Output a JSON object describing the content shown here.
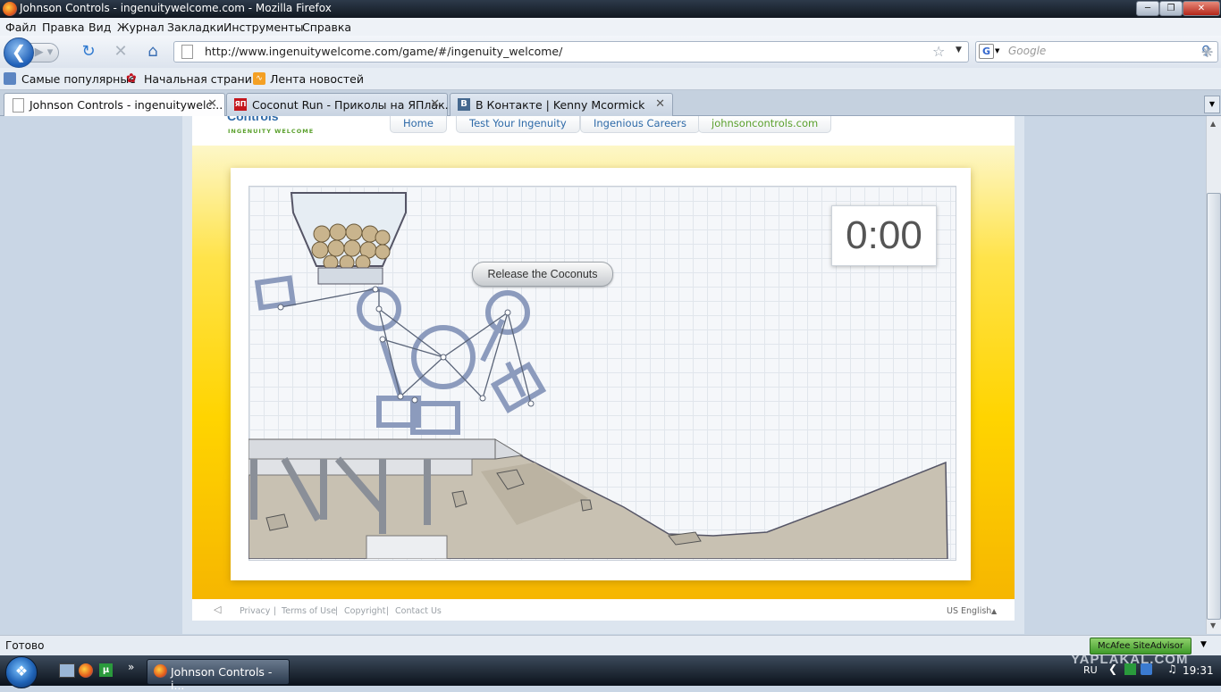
{
  "window": {
    "title": "Johnson Controls - ingenuitywelcome.com - Mozilla Firefox"
  },
  "menu": [
    "Файл",
    "Правка",
    "Вид",
    "Журнал",
    "Закладки",
    "Инструменты",
    "Справка"
  ],
  "nav": {
    "url": "http://www.ingenuitywelcome.com/game/#/ingenuity_welcome/",
    "search_placeholder": "Google"
  },
  "bookmarks": [
    "Самые популярные",
    "Начальная страница",
    "Лента новостей"
  ],
  "tabs": [
    {
      "label": "Johnson Controls - ingenuitywelc...",
      "active": true
    },
    {
      "label": "Coconut Run - Приколы на ЯПлак...",
      "icon": "ЯП"
    },
    {
      "label": "В Контакте | Kenny Mcormick",
      "icon": "B"
    }
  ],
  "site": {
    "logo_text": "Controls",
    "logo_sub": "INGENUITY WELCOME",
    "nav": [
      "Home",
      "Test Your Ingenuity",
      "Ingenious Careers",
      "johnsoncontrols.com"
    ],
    "timer": "0:00",
    "release_button": "Release the Coconuts",
    "footer_links": [
      "Privacy",
      "Terms of Use",
      "Copyright",
      "Contact Us"
    ],
    "language": "US English"
  },
  "status": {
    "text": "Готово",
    "mcafee": "McAfee SiteAdvisor"
  },
  "taskbar": {
    "item": "Johnson Controls - i...",
    "lang": "RU",
    "clock": "19:31"
  },
  "watermark": "YAPLAKAL.COM",
  "colors": {
    "accent_yellow": "#ffd400",
    "link_blue": "#2e6aa8",
    "green_link": "#5aa02c"
  }
}
